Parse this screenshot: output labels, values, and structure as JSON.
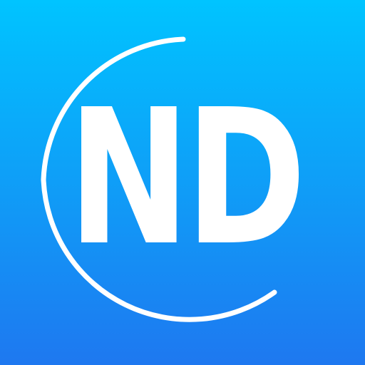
{
  "icon": {
    "monogram": "ND",
    "symbol": "circular-arc-icon"
  },
  "colors": {
    "gradient_top": "#00c4ff",
    "gradient_bottom": "#1e78f0",
    "foreground": "#ffffff"
  }
}
